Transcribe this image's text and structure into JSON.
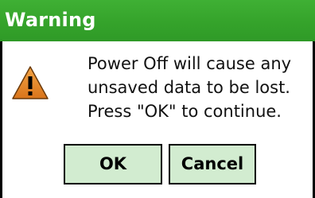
{
  "dialog": {
    "title": "Warning",
    "icon": "warning-icon",
    "message_lines": [
      "Power Off will cause any",
      "unsaved data to be lost.",
      "Press \"OK\" to continue."
    ],
    "buttons": {
      "ok_label": "OK",
      "cancel_label": "Cancel"
    }
  },
  "colors": {
    "title_bar": "#35a32b",
    "button_fill": "#d2ecd0",
    "warning_icon": "#e8871e"
  }
}
